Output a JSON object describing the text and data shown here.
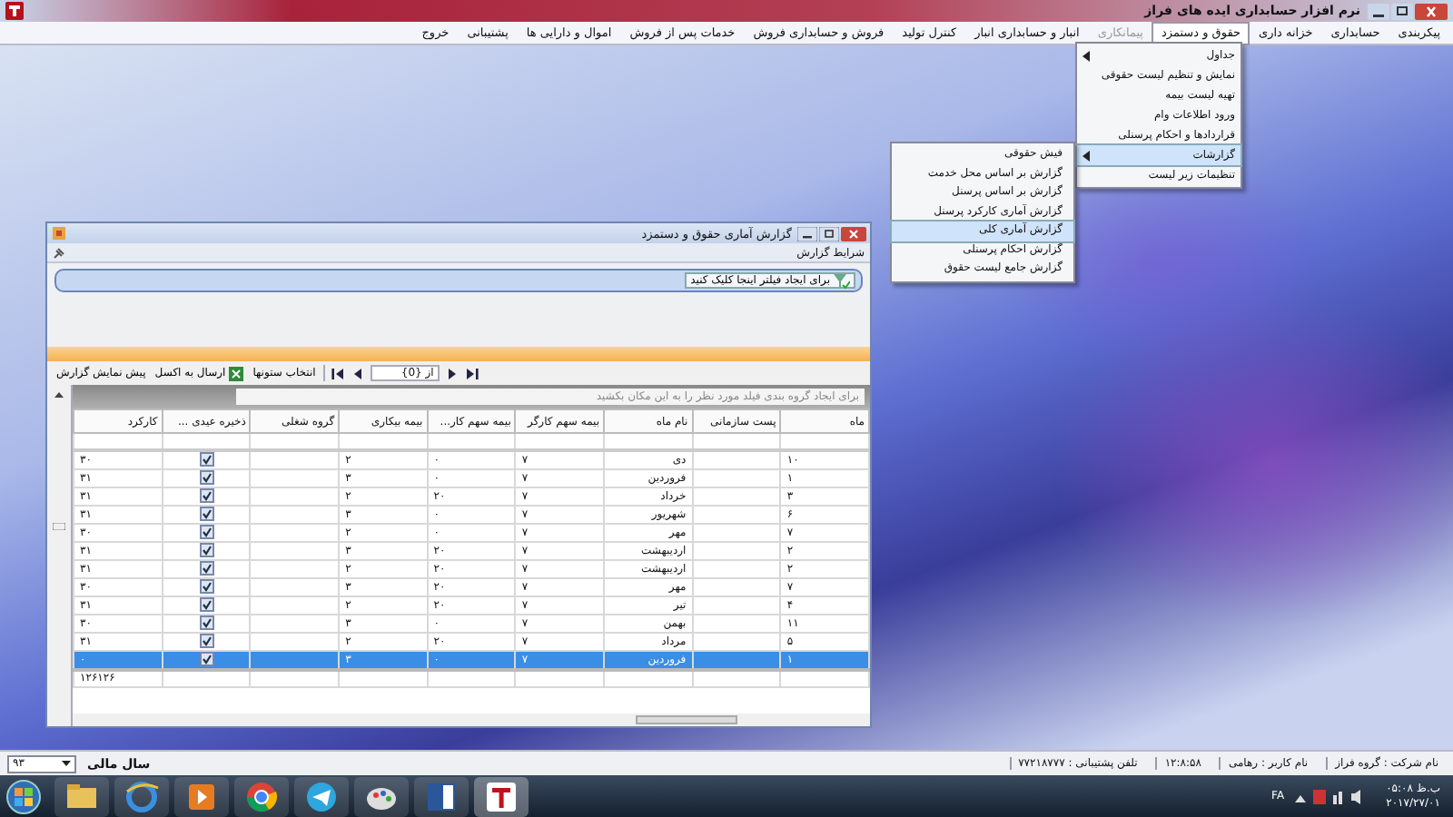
{
  "app": {
    "title": "نرم افزار حسابداری ایده های فراز"
  },
  "menu_bar": [
    {
      "label": "پیکربندی",
      "selected": false,
      "disabled": false
    },
    {
      "label": "حسابداری",
      "selected": false,
      "disabled": false
    },
    {
      "label": "خزانه داری",
      "selected": false,
      "disabled": false
    },
    {
      "label": "حقوق و دستمزد",
      "selected": true,
      "disabled": false
    },
    {
      "label": "پیمانکاری",
      "selected": false,
      "disabled": true
    },
    {
      "label": "انبار و حسابداری انبار",
      "selected": false,
      "disabled": false
    },
    {
      "label": "کنترل تولید",
      "selected": false,
      "disabled": false
    },
    {
      "label": "فروش و حسابداری فروش",
      "selected": false,
      "disabled": false
    },
    {
      "label": "خدمات پس از فروش",
      "selected": false,
      "disabled": false
    },
    {
      "label": "اموال و دارایی ها",
      "selected": false,
      "disabled": false
    },
    {
      "label": "پشتیبانی",
      "selected": false,
      "disabled": false
    },
    {
      "label": "خروج",
      "selected": false,
      "disabled": false
    }
  ],
  "dropdown": {
    "items": [
      {
        "label": "جداول",
        "selected": false,
        "has_submenu": true
      },
      {
        "label": "نمایش و تنظیم لیست حقوقی",
        "selected": false,
        "has_submenu": false
      },
      {
        "label": "تهیه لیست بیمه",
        "selected": false,
        "has_submenu": false
      },
      {
        "label": "ورود اطلاعات وام",
        "selected": false,
        "has_submenu": false
      },
      {
        "label": "قراردادها و احکام پرسنلی",
        "selected": false,
        "has_submenu": false
      },
      {
        "label": "گزارشات",
        "selected": true,
        "has_submenu": true
      },
      {
        "label": "تنظیمات زیر لیست",
        "selected": false,
        "has_submenu": false
      }
    ]
  },
  "submenu": {
    "items": [
      {
        "label": "فیش حقوقی",
        "selected": false
      },
      {
        "label": "گزارش بر اساس محل خدمت",
        "selected": false
      },
      {
        "label": "گزارش بر اساس پرسنل",
        "selected": false
      },
      {
        "label": "گزارش آماری کارکرد پرسنل",
        "selected": false
      },
      {
        "label": "گزارش آماری کلی",
        "selected": true
      },
      {
        "label": "گزارش احکام پرسنلی",
        "selected": false
      },
      {
        "label": "گزارش جامع لیست حقوق",
        "selected": false
      }
    ]
  },
  "report_window": {
    "title": "گزارش آماری حقوق و دستمزد",
    "panel_title": "شرایط گزارش",
    "filter_button": "برای ایجاد فیلتر اینجا کلیک کنید",
    "toolbar": {
      "page_text": "از {0}",
      "columns_button": "انتخاب ستونها",
      "excel_button": "ارسال به اکسل",
      "preview_button": "پیش نمایش گزارش"
    },
    "group_hint": "برای ایجاد گروه بندی فیلد مورد نظر را به این مکان بکشید",
    "table": {
      "columns": [
        "ماه",
        "پست سازمانی",
        "نام ماه",
        "بیمه سهم کارگر",
        "بیمه سهم کار...",
        "بیمه بیکاری",
        "گروه شغلی",
        "ذخیره عیدی ...",
        "کارکرد"
      ],
      "rows": [
        {
          "month": "۱۰",
          "month_name": "دی",
          "worker_insurance": "۷",
          "employer_insurance": "۰",
          "unemployment_insurance": "۲",
          "bonus_reserve": true,
          "work_days": "۳۰",
          "selected": false
        },
        {
          "month": "۱",
          "month_name": "فروردین",
          "worker_insurance": "۷",
          "employer_insurance": "۰",
          "unemployment_insurance": "۳",
          "bonus_reserve": true,
          "work_days": "۳۱",
          "selected": false
        },
        {
          "month": "۳",
          "month_name": "خرداد",
          "worker_insurance": "۷",
          "employer_insurance": "۲۰",
          "unemployment_insurance": "۲",
          "bonus_reserve": true,
          "work_days": "۳۱",
          "selected": false
        },
        {
          "month": "۶",
          "month_name": "شهریور",
          "worker_insurance": "۷",
          "employer_insurance": "۰",
          "unemployment_insurance": "۳",
          "bonus_reserve": true,
          "work_days": "۳۱",
          "selected": false
        },
        {
          "month": "۷",
          "month_name": "مهر",
          "worker_insurance": "۷",
          "employer_insurance": "۰",
          "unemployment_insurance": "۲",
          "bonus_reserve": true,
          "work_days": "۳۰",
          "selected": false
        },
        {
          "month": "۲",
          "month_name": "اردیبهشت",
          "worker_insurance": "۷",
          "employer_insurance": "۲۰",
          "unemployment_insurance": "۳",
          "bonus_reserve": true,
          "work_days": "۳۱",
          "selected": false
        },
        {
          "month": "۲",
          "month_name": "اردیبهشت",
          "worker_insurance": "۷",
          "employer_insurance": "۲۰",
          "unemployment_insurance": "۲",
          "bonus_reserve": true,
          "work_days": "۳۱",
          "selected": false
        },
        {
          "month": "۷",
          "month_name": "مهر",
          "worker_insurance": "۷",
          "employer_insurance": "۲۰",
          "unemployment_insurance": "۳",
          "bonus_reserve": true,
          "work_days": "۳۰",
          "selected": false
        },
        {
          "month": "۴",
          "month_name": "تیر",
          "worker_insurance": "۷",
          "employer_insurance": "۲۰",
          "unemployment_insurance": "۲",
          "bonus_reserve": true,
          "work_days": "۳۱",
          "selected": false
        },
        {
          "month": "۱۱",
          "month_name": "بهمن",
          "worker_insurance": "۷",
          "employer_insurance": "۰",
          "unemployment_insurance": "۳",
          "bonus_reserve": true,
          "work_days": "۳۰",
          "selected": false
        },
        {
          "month": "۵",
          "month_name": "مرداد",
          "worker_insurance": "۷",
          "employer_insurance": "۲۰",
          "unemployment_insurance": "۲",
          "bonus_reserve": true,
          "work_days": "۳۱",
          "selected": false
        },
        {
          "month": "۱",
          "month_name": "فروردین",
          "worker_insurance": "۷",
          "employer_insurance": "۰",
          "unemployment_insurance": "۳",
          "bonus_reserve": true,
          "work_days": "۰",
          "selected": true
        }
      ],
      "footer_total": "۱۲۶۱۲۶"
    }
  },
  "status_bar": {
    "fiscal_year": "۹۳",
    "fiscal_year_label": "سال مالی",
    "company": "نام شرکت : گروه فراز",
    "user": "نام کاربر : رهامی",
    "time": "۱۲:۸:۵۸",
    "phone": "تلفن پشتیبانی : ۷۷۲۱۸۷۷۷"
  },
  "taskbar": {
    "language": "FA",
    "time": "ب.ظ ۰۵:۰۸",
    "date": "۲۰۱۷/۲۷/۰۱"
  }
}
